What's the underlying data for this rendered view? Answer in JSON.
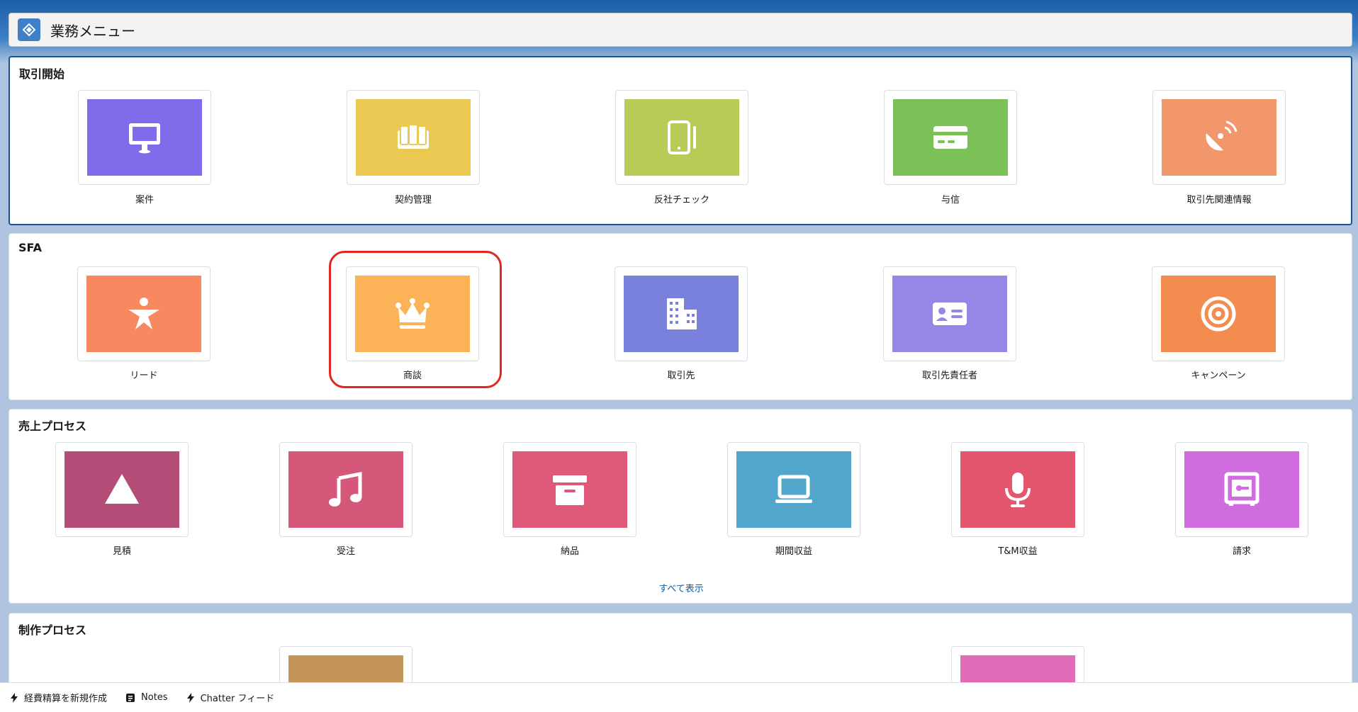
{
  "header": {
    "title": "業務メニュー",
    "icon": "app-switch-icon"
  },
  "sections": [
    {
      "title": "取引開始",
      "tiles": [
        {
          "label": "案件",
          "color": "#7f6cea",
          "icon": "desktop-icon"
        },
        {
          "label": "契約管理",
          "color": "#ebc852",
          "icon": "knowledge-book-icon"
        },
        {
          "label": "反社チェック",
          "color": "#b6cc57",
          "icon": "tablet-icon"
        },
        {
          "label": "与信",
          "color": "#7cc157",
          "icon": "credit-card-icon"
        },
        {
          "label": "取引先関連情報",
          "color": "#f2966b",
          "icon": "satellite-dish-icon"
        }
      ]
    },
    {
      "title": "SFA",
      "tiles": [
        {
          "label": "リード",
          "color": "#f7885f",
          "icon": "lead-person-icon"
        },
        {
          "label": "商談",
          "color": "#fcb256",
          "icon": "crown-icon"
        },
        {
          "label": "取引先",
          "color": "#7a81dd",
          "icon": "building-icon"
        },
        {
          "label": "取引先責任者",
          "color": "#9487e6",
          "icon": "contact-card-icon"
        },
        {
          "label": "キャンペーン",
          "color": "#f28c4f",
          "icon": "target-icon"
        }
      ]
    },
    {
      "title": "売上プロセス",
      "tiles": [
        {
          "label": "見積",
          "color": "#b54d79",
          "icon": "triangle-icon"
        },
        {
          "label": "受注",
          "color": "#d5587a",
          "icon": "music-note-icon"
        },
        {
          "label": "納品",
          "color": "#de5879",
          "icon": "archive-box-icon"
        },
        {
          "label": "期間収益",
          "color": "#52a6cc",
          "icon": "laptop-icon"
        },
        {
          "label": "T&M収益",
          "color": "#e4566e",
          "icon": "microphone-icon"
        },
        {
          "label": "請求",
          "color": "#d06ce0",
          "icon": "safe-icon"
        }
      ],
      "view_all": "すべて表示"
    },
    {
      "title": "制作プロセス",
      "tiles": [
        {
          "label": "",
          "color": "#c4955a",
          "icon": "partial-icon"
        },
        {
          "label": "",
          "color": "#e06bb8",
          "icon": "partial-icon"
        }
      ]
    }
  ],
  "utility_bar": [
    {
      "label": "経費精算を新規作成",
      "icon": "lightning-icon"
    },
    {
      "label": "Notes",
      "icon": "notes-icon"
    },
    {
      "label": "Chatter フィード",
      "icon": "lightning-icon"
    }
  ]
}
